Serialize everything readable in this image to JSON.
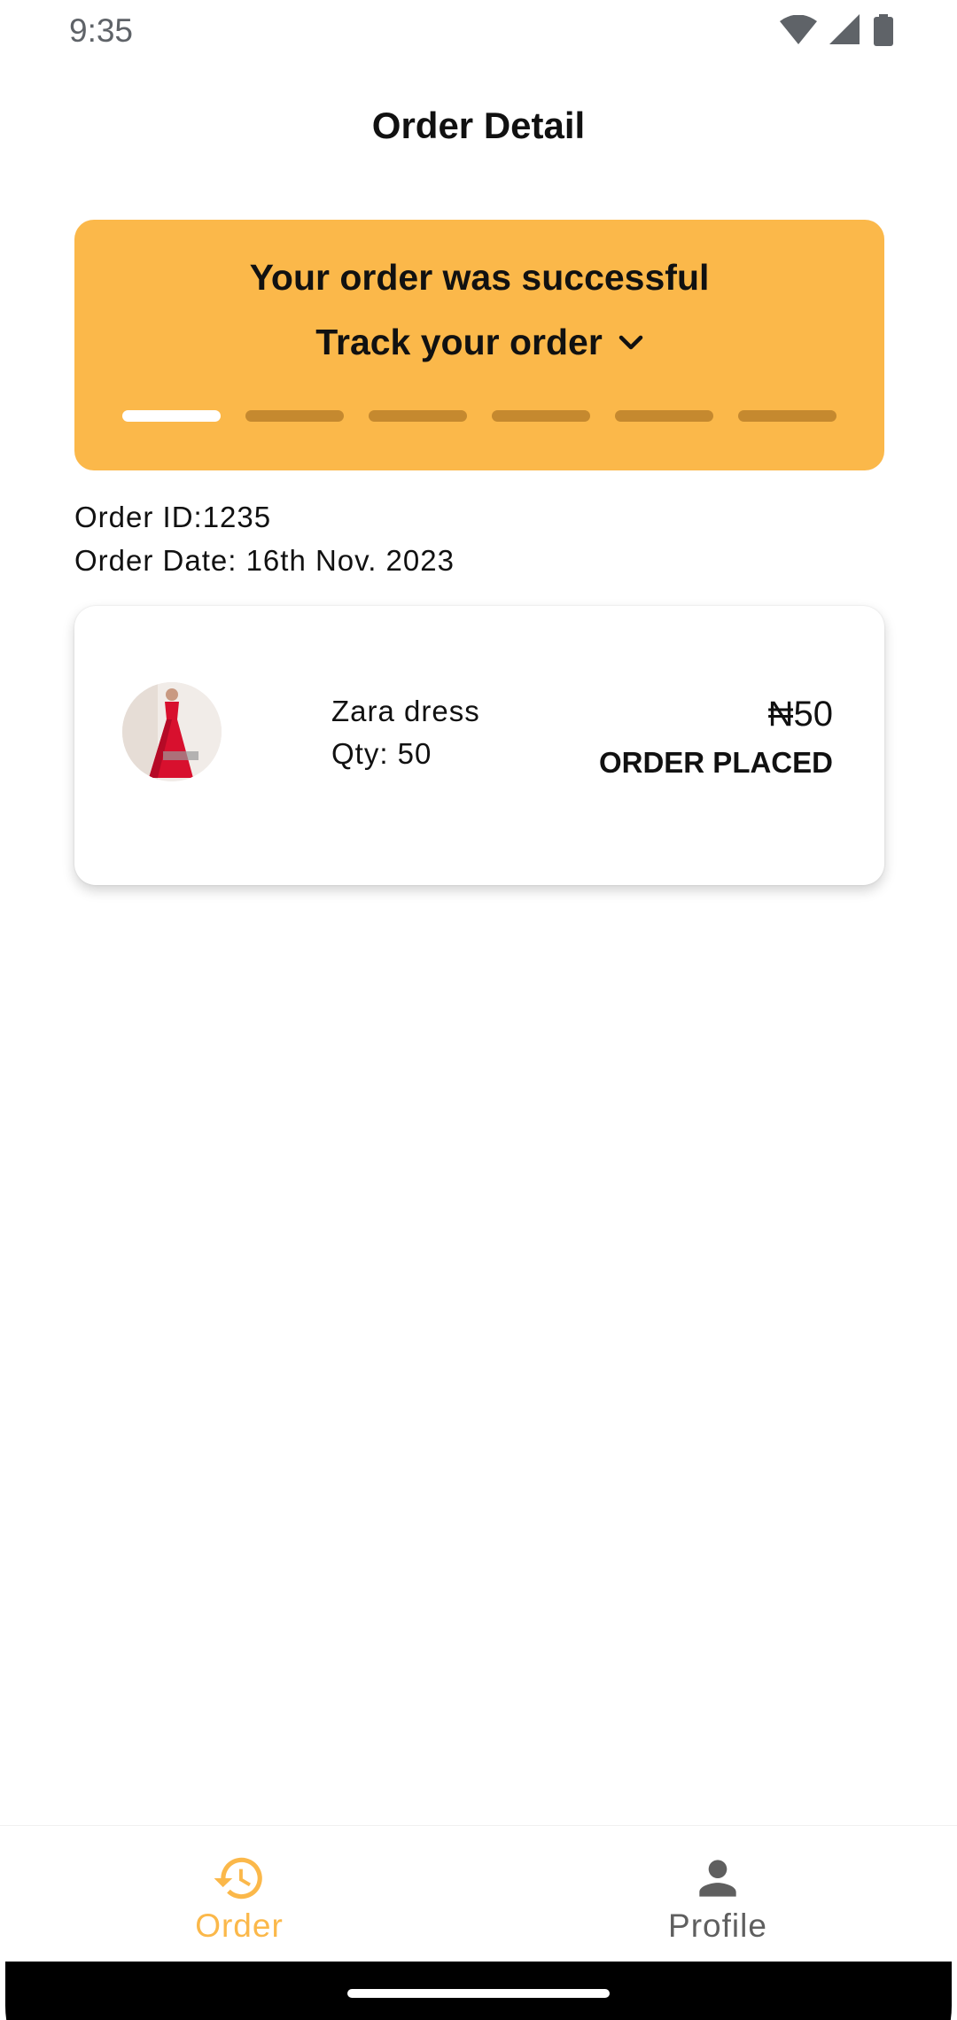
{
  "status_bar": {
    "time": "9:35",
    "icons": [
      "wifi-icon",
      "signal-icon",
      "battery-icon"
    ]
  },
  "app_bar": {
    "title": "Order Detail"
  },
  "banner": {
    "title": "Your order was successful",
    "track_label": "Track your order",
    "track_icon": "chevron-down-icon",
    "steps_total": 6,
    "steps_completed": 1,
    "background": "#fbb84a"
  },
  "order": {
    "id_label": "Order ID:1235",
    "date_label": "Order Date: 16th Nov. 2023"
  },
  "item": {
    "name": "Zara dress",
    "qty": "Qty: 50",
    "price": "₦50",
    "status": "ORDER PLACED"
  },
  "bottom_nav": {
    "items": [
      {
        "label": "Order",
        "icon": "order-history-icon",
        "active": true
      },
      {
        "label": "Profile",
        "icon": "person-icon",
        "active": false
      }
    ],
    "active_color": "#fbb84a"
  }
}
